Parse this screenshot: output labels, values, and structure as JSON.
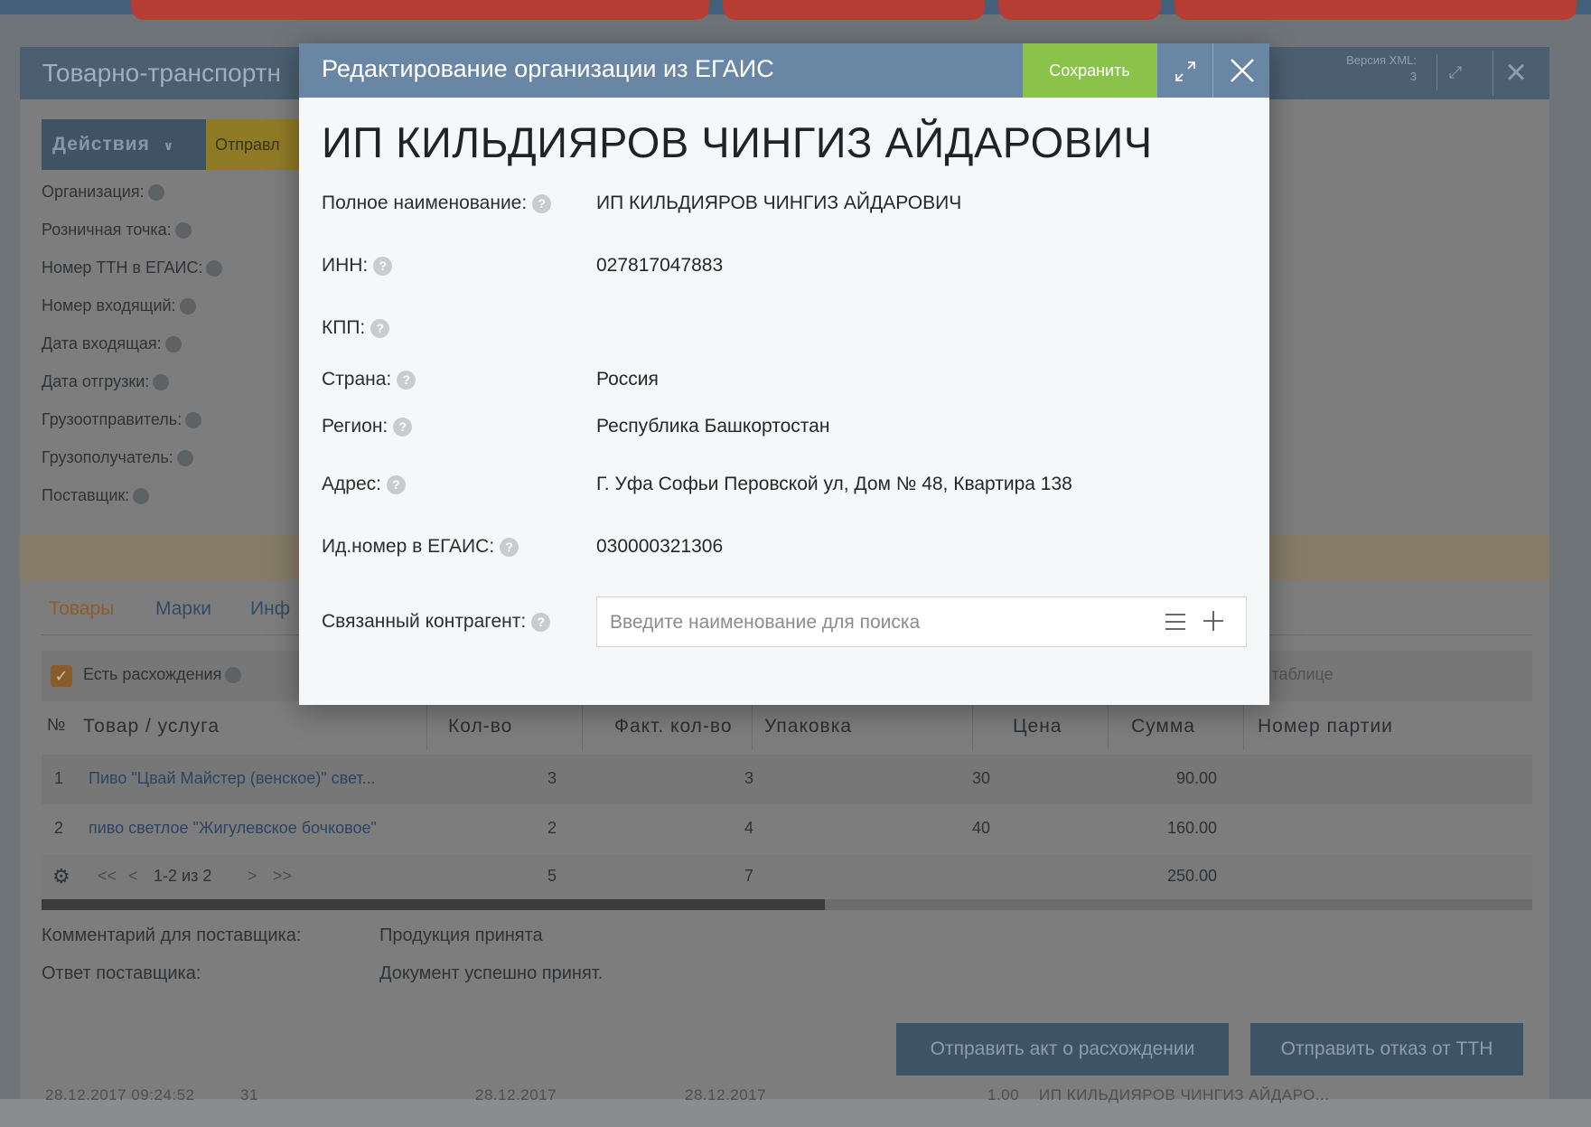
{
  "background_doc": {
    "title": "Товарно-транспортн",
    "xml_version_label": "Версия XML:",
    "xml_version_value": "3",
    "actions_label": "Действия",
    "send_label": "Отправл",
    "fields": [
      "Организация:",
      "Розничная точка:",
      "Номер ТТН в ЕГАИС:",
      "Номер входящий:",
      "Дата входящая:",
      "Дата отгрузки:",
      "Грузоотправитель:",
      "Грузополучатель:",
      "Поставщик:"
    ],
    "tabs": [
      "Товары",
      "Марки",
      "Инф"
    ],
    "has_discrepancies_label": "Есть расхождения",
    "table_search_placeholder": "поиск по таблице",
    "table": {
      "headers": [
        "№",
        "Товар / услуга",
        "Кол-во",
        "Факт. кол-во",
        "Упаковка",
        "Цена",
        "Сумма",
        "Номер партии"
      ],
      "rows": [
        {
          "num": "1",
          "product": "Пиво \"Цвай Майстер (венское)\" свет...",
          "qty": "3",
          "fact_qty": "3",
          "price": "30",
          "sum": "90.00"
        },
        {
          "num": "2",
          "product": "пиво светлое \"Жигулевское бочковое\"",
          "qty": "2",
          "fact_qty": "4",
          "price": "40",
          "sum": "160.00"
        }
      ],
      "pager": "1-2 из 2",
      "pager_first": "<<",
      "pager_prev": "<",
      "pager_next": ">",
      "pager_last": ">>",
      "total_qty": "5",
      "total_fact_qty": "7",
      "total_sum": "250.00"
    },
    "comment_label": "Комментарий для поставщика:",
    "comment_value": "Продукция принята",
    "answer_label": "Ответ поставщика:",
    "answer_value": "Документ успешно принят.",
    "btn_discrepancy": "Отправить акт о расхождении",
    "btn_reject": "Отправить отказ от ТТН",
    "bottom_row": {
      "datetime": "28.12.2017 09:24:52",
      "num": "31",
      "date1": "28.12.2017",
      "date2": "28.12.2017",
      "qty": "1.00",
      "org": "ИП КИЛЬДИЯРОВ ЧИНГИЗ АЙДАРО..."
    }
  },
  "modal": {
    "title": "Редактирование организации из ЕГАИС",
    "save_label": "Сохранить",
    "org_name": "ИП КИЛЬДИЯРОВ ЧИНГИЗ АЙДАРОВИЧ",
    "fields": {
      "full_name": {
        "label": "Полное наименование:",
        "value": "ИП КИЛЬДИЯРОВ ЧИНГИЗ АЙДАРОВИЧ"
      },
      "inn": {
        "label": "ИНН:",
        "value": "027817047883"
      },
      "kpp": {
        "label": "КПП:",
        "value": ""
      },
      "country": {
        "label": "Страна:",
        "value": "Россия"
      },
      "region": {
        "label": "Регион:",
        "value": "Республика Башкортостан"
      },
      "address": {
        "label": "Адрес:",
        "value": "Г. Уфа Софьи Перовской ул, Дом № 48, Квартира 138"
      },
      "egais_id": {
        "label": "Ид.номер в ЕГАИС:",
        "value": "030000321306"
      },
      "linked": {
        "label": "Связанный контрагент:",
        "placeholder": "Введите наименование для поиска"
      }
    },
    "help_glyph": "?"
  },
  "colors": {
    "modal_header": "#6987a4",
    "save_button": "#8bc34a",
    "overlay_dim": "#6f7478"
  }
}
